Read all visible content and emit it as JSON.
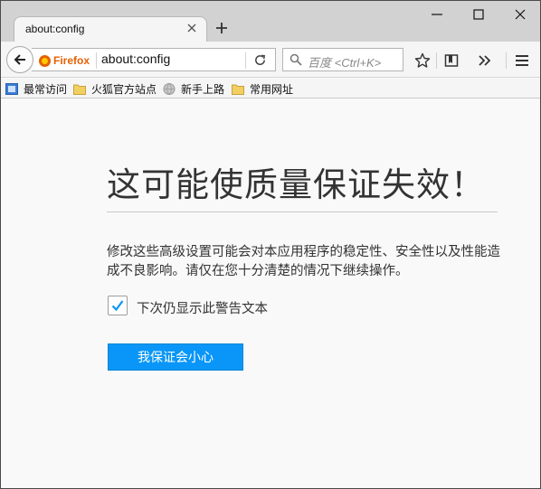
{
  "tab": {
    "title": "about:config"
  },
  "urlbar": {
    "identity_label": "Firefox",
    "url": "about:config"
  },
  "searchbar": {
    "placeholder": "百度 <Ctrl+K>"
  },
  "bookmarks": [
    {
      "label": "最常访问",
      "icon": "bookmark-star-icon"
    },
    {
      "label": "火狐官方站点",
      "icon": "folder-icon"
    },
    {
      "label": "新手上路",
      "icon": "globe-icon"
    },
    {
      "label": "常用网址",
      "icon": "folder-icon"
    }
  ],
  "warning": {
    "title": "这可能使质量保证失效！",
    "message": "修改这些高级设置可能会对本应用程序的稳定性、安全性以及性能造成不良影响。请仅在您十分清楚的情况下继续操作。",
    "checkbox_label": "下次仍显示此警告文本",
    "checkbox_checked": true,
    "accept_button": "我保证会小心"
  },
  "colors": {
    "accent": "#0996f8",
    "identity": "#e66000"
  }
}
